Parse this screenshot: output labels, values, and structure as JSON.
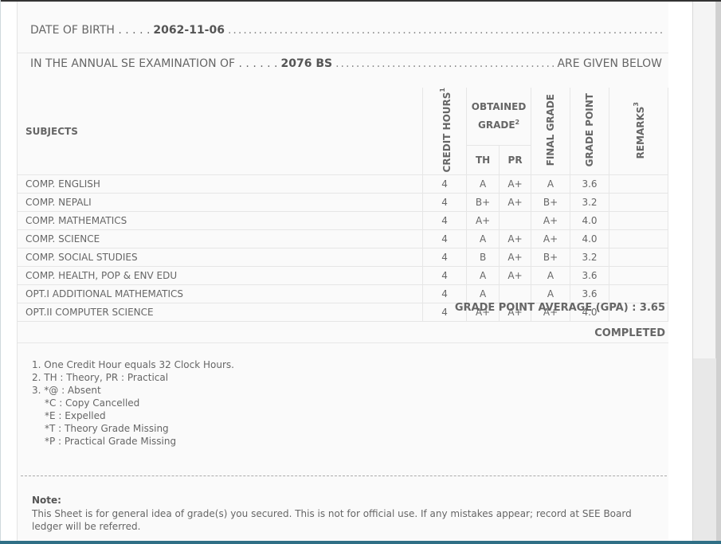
{
  "student": {
    "dob_label": "DATE OF BIRTH . . . . .",
    "dob_value": "2062-11-06",
    "exam_label": "IN THE ANNUAL SE EXAMINATION OF . . . . . .",
    "exam_value": "2076 BS",
    "exam_suffix": "ARE GIVEN BELOW"
  },
  "table": {
    "headers": {
      "subjects": "SUBJECTS",
      "credit_hours": "CREDIT HOURS",
      "credit_hours_sup": "1",
      "obtained_grade_line1": "OBTAINED",
      "obtained_grade_line2": "GRADE",
      "obtained_grade_sup": "2",
      "th": "TH",
      "pr": "PR",
      "final_grade": "FINAL GRADE",
      "grade_point": "GRADE POINT",
      "remarks": "REMARKS",
      "remarks_sup": "3"
    },
    "rows": [
      {
        "subject": "COMP. ENGLISH",
        "credit": "4",
        "th": "A",
        "pr": "A+",
        "final": "A",
        "point": "3.6",
        "remarks": ""
      },
      {
        "subject": "COMP. NEPALI",
        "credit": "4",
        "th": "B+",
        "pr": "A+",
        "final": "B+",
        "point": "3.2",
        "remarks": ""
      },
      {
        "subject": "COMP. MATHEMATICS",
        "credit": "4",
        "th": "A+",
        "pr": "",
        "final": "A+",
        "point": "4.0",
        "remarks": ""
      },
      {
        "subject": "COMP. SCIENCE",
        "credit": "4",
        "th": "A",
        "pr": "A+",
        "final": "A+",
        "point": "4.0",
        "remarks": ""
      },
      {
        "subject": "COMP. SOCIAL STUDIES",
        "credit": "4",
        "th": "B",
        "pr": "A+",
        "final": "B+",
        "point": "3.2",
        "remarks": ""
      },
      {
        "subject": "COMP. HEALTH, POP & ENV EDU",
        "credit": "4",
        "th": "A",
        "pr": "A+",
        "final": "A",
        "point": "3.6",
        "remarks": ""
      },
      {
        "subject": "OPT.I ADDITIONAL MATHEMATICS",
        "credit": "4",
        "th": "A",
        "pr": "",
        "final": "A",
        "point": "3.6",
        "remarks": ""
      },
      {
        "subject": "OPT.II COMPUTER SCIENCE",
        "credit": "4",
        "th": "A+",
        "pr": "A+",
        "final": "A+",
        "point": "4.0",
        "remarks": ""
      }
    ]
  },
  "summary": {
    "gpa_text": "GRADE POINT AVERAGE (GPA) : 3.65",
    "status": "COMPLETED"
  },
  "legend": [
    {
      "text": "1. One Credit Hour equals 32 Clock Hours.",
      "indent": false
    },
    {
      "text": "2. TH : Theory, PR : Practical",
      "indent": false
    },
    {
      "text": "3. *@ : Absent",
      "indent": false
    },
    {
      "text": "*C : Copy Cancelled",
      "indent": true
    },
    {
      "text": "*E : Expelled",
      "indent": true
    },
    {
      "text": "*T : Theory Grade Missing",
      "indent": true
    },
    {
      "text": "*P : Practical Grade Missing",
      "indent": true
    }
  ],
  "note": {
    "title": "Note:",
    "text": "This Sheet is for general idea of grade(s) you secured. This is not for official use. If any mistakes appear; record at SEE Board ledger will be referred."
  },
  "colors": {
    "page_bg": "#fafafa",
    "text": "#666666",
    "border": "#e6e6e6",
    "bottom_bar": "#2f6f86"
  }
}
